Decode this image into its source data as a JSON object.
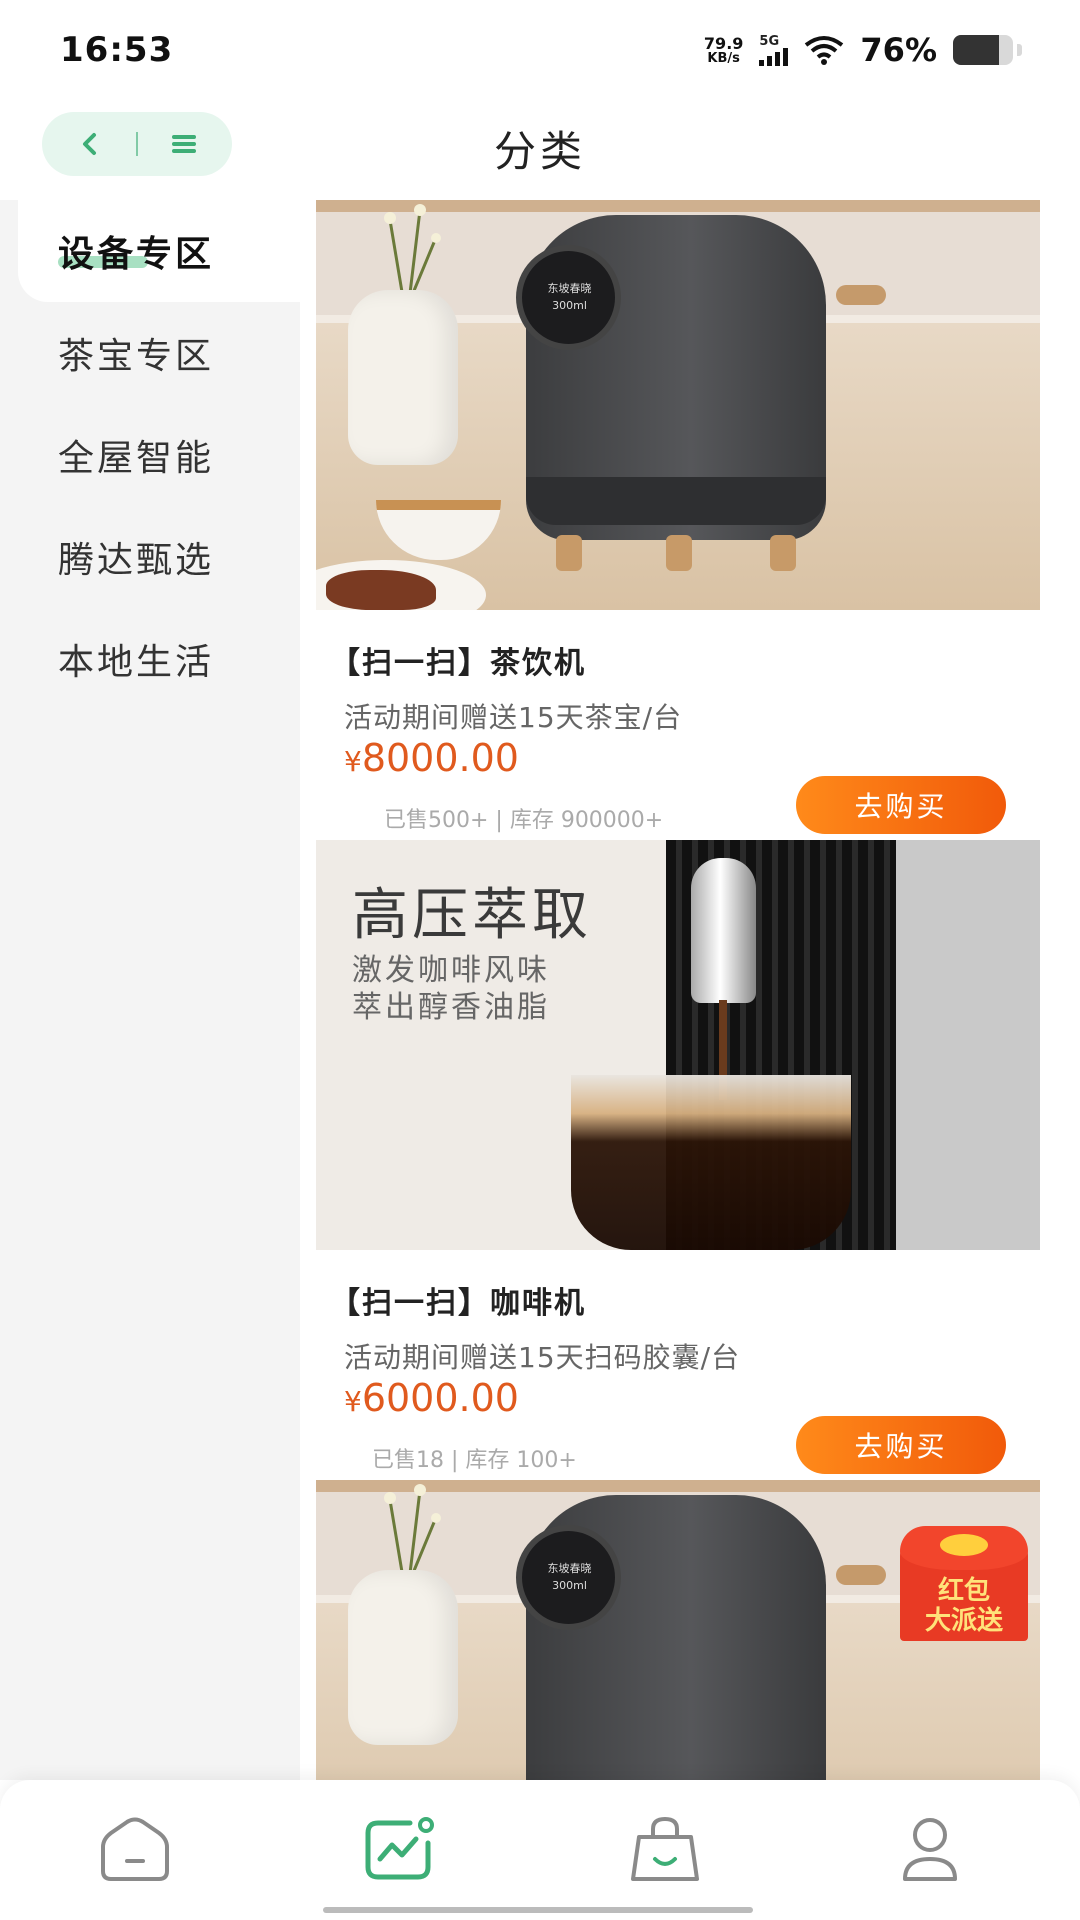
{
  "status_bar": {
    "time": "16:53",
    "net_speed_value": "79.9",
    "net_speed_unit": "KB/s",
    "network": "5G",
    "battery_percent": "76%",
    "battery_level": 0.76
  },
  "header": {
    "title": "分类",
    "back_icon": "chevron-left-icon",
    "menu_icon": "menu-icon"
  },
  "sidebar": {
    "items": [
      {
        "label": "设备专区",
        "active": true
      },
      {
        "label": "茶宝专区",
        "active": false
      },
      {
        "label": "全屋智能",
        "active": false
      },
      {
        "label": "腾达甄选",
        "active": false
      },
      {
        "label": "本地生活",
        "active": false
      }
    ]
  },
  "products": [
    {
      "title": "【扫一扫】茶饮机",
      "promo": "活动期间赠送15天茶宝/台",
      "currency": "¥",
      "price": "8000.00",
      "stats": "已售500+ | 库存 900000+",
      "buy_label": "去购买",
      "image_text": {
        "dial": "东坡春晓",
        "volume": "300ml"
      }
    },
    {
      "title": "【扫一扫】咖啡机",
      "promo": "活动期间赠送15天扫码胶囊/台",
      "currency": "¥",
      "price": "6000.00",
      "stats": "已售18 | 库存 100+",
      "buy_label": "去购买",
      "image_text": {
        "headline": "高压萃取",
        "sub1": "激发咖啡风味",
        "sub2": "萃出醇香油脂"
      }
    },
    {
      "image_text": {
        "dial": "东坡春晓",
        "volume": "300ml",
        "badge_line1": "红包",
        "badge_line2": "大派送"
      }
    }
  ],
  "bottom_nav": {
    "items": [
      {
        "icon": "home-icon",
        "active": false
      },
      {
        "icon": "category-chart-icon",
        "active": true
      },
      {
        "icon": "shopping-bag-icon",
        "active": false
      },
      {
        "icon": "user-icon",
        "active": false
      }
    ]
  },
  "colors": {
    "accent": "#3dae76",
    "price": "#e05a1e",
    "button_start": "#ff8a1a",
    "button_end": "#f15a0a",
    "sidebar_bg": "#f4f4f4"
  }
}
